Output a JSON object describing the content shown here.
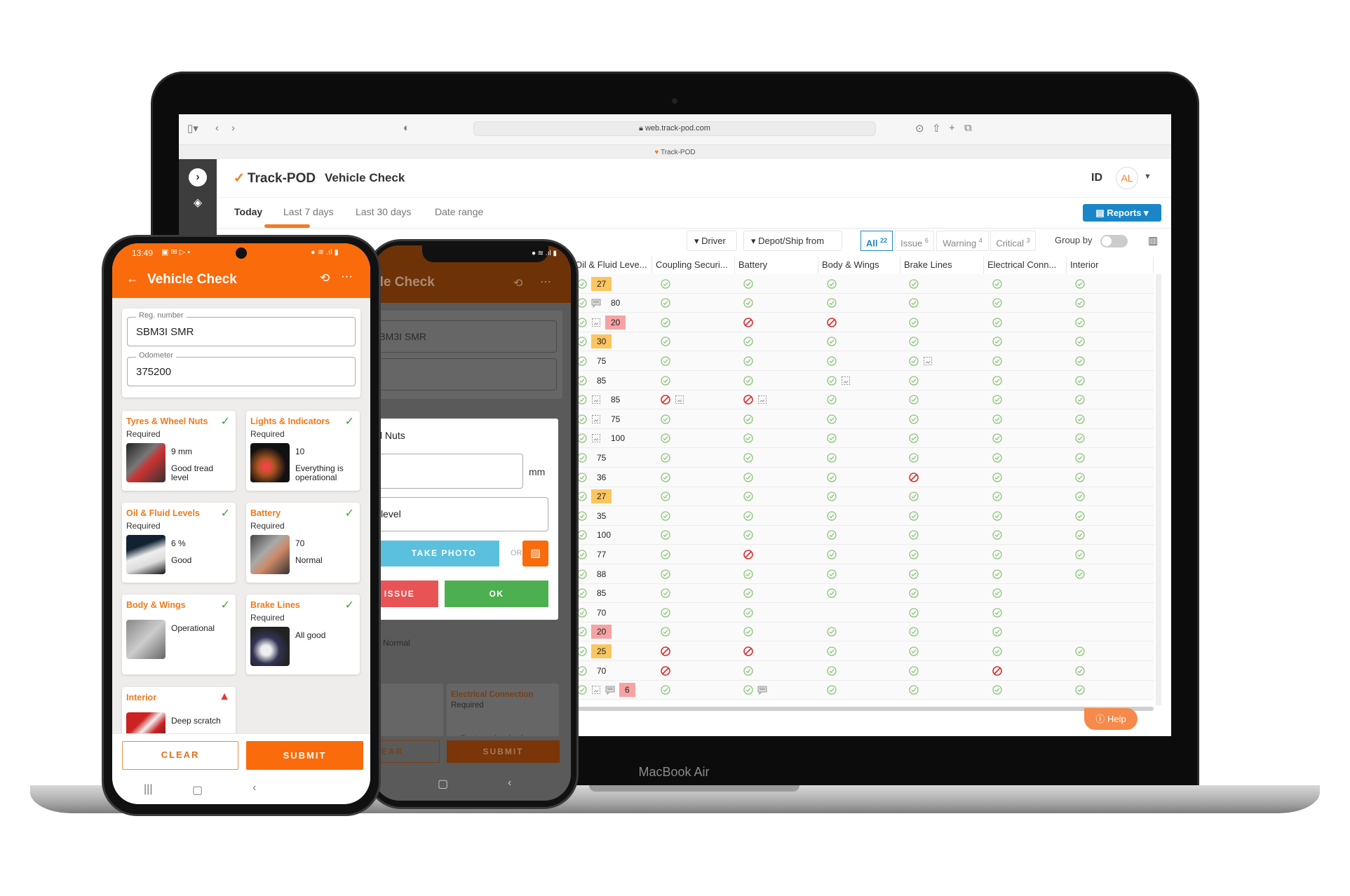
{
  "device_label": "MacBook Air",
  "browser": {
    "url": "web.track-pod.com",
    "tab_title": "Track-POD"
  },
  "app": {
    "logo_text": "Track-POD",
    "page_title": "Vehicle Check",
    "id_label": "ID",
    "avatar_initials": "AL",
    "brand_color": "#f47a20"
  },
  "tabs": [
    {
      "label": "Today",
      "active": true
    },
    {
      "label": "Last 7 days"
    },
    {
      "label": "Last 30 days"
    },
    {
      "label": "Date range"
    }
  ],
  "reports_label": "Reports",
  "filters": {
    "driver": "Driver",
    "depot": "Depot/Ship from",
    "segments": [
      {
        "label": "All",
        "count": "22",
        "active": true
      },
      {
        "label": "Issue",
        "count": "6"
      },
      {
        "label": "Warning",
        "count": "4"
      },
      {
        "label": "Critical",
        "count": "3"
      }
    ],
    "group_by": "Group by",
    "group_by_on": false
  },
  "table": {
    "columns": [
      "Oil & Fluid Leve...",
      "Coupling Securi...",
      "Battery",
      "Body & Wings",
      "Brake Lines",
      "Electrical Conn...",
      "Interior"
    ],
    "rows": [
      {
        "oil": {
          "icons": [],
          "value": "27",
          "level": "warn"
        },
        "cells": [
          "ok",
          "ok",
          "ok",
          "ok",
          "ok",
          "ok"
        ]
      },
      {
        "oil": {
          "icons": [
            "comment"
          ],
          "value": "80",
          "level": ""
        },
        "cells": [
          "ok",
          "ok",
          "ok",
          "ok",
          "ok",
          "ok"
        ]
      },
      {
        "oil": {
          "icons": [
            "photo"
          ],
          "value": "20",
          "level": "crit"
        },
        "cells": [
          "ok",
          "x",
          "x",
          "ok",
          "ok",
          "ok"
        ]
      },
      {
        "oil": {
          "icons": [],
          "value": "30",
          "level": "warn"
        },
        "cells": [
          "ok",
          "ok",
          "ok",
          "ok",
          "ok",
          "ok"
        ]
      },
      {
        "oil": {
          "icons": [],
          "value": "75",
          "level": ""
        },
        "cells": [
          "ok",
          "ok",
          "ok",
          "ok photo",
          "ok",
          "ok"
        ]
      },
      {
        "oil": {
          "icons": [],
          "value": "85",
          "level": ""
        },
        "cells": [
          "ok",
          "ok",
          "ok photo",
          "ok",
          "ok",
          "ok"
        ]
      },
      {
        "oil": {
          "icons": [
            "photo"
          ],
          "value": "85",
          "level": ""
        },
        "cells": [
          "x photo",
          "x photo",
          "ok",
          "ok",
          "ok",
          "ok"
        ]
      },
      {
        "oil": {
          "icons": [
            "photo"
          ],
          "value": "75",
          "level": ""
        },
        "cells": [
          "ok",
          "ok",
          "ok",
          "ok",
          "ok",
          "ok"
        ]
      },
      {
        "oil": {
          "icons": [
            "photo"
          ],
          "value": "100",
          "level": ""
        },
        "cells": [
          "ok",
          "ok",
          "ok",
          "ok",
          "ok",
          "ok"
        ]
      },
      {
        "oil": {
          "icons": [],
          "value": "75",
          "level": ""
        },
        "cells": [
          "ok",
          "ok",
          "ok",
          "ok",
          "ok",
          "ok"
        ]
      },
      {
        "oil": {
          "icons": [],
          "value": "36",
          "level": ""
        },
        "cells": [
          "ok",
          "ok",
          "ok",
          "x",
          "ok",
          "ok"
        ]
      },
      {
        "oil": {
          "icons": [],
          "value": "27",
          "level": "warn"
        },
        "cells": [
          "ok",
          "ok",
          "ok",
          "ok",
          "ok",
          "ok"
        ]
      },
      {
        "oil": {
          "icons": [],
          "value": "35",
          "level": ""
        },
        "cells": [
          "ok",
          "ok",
          "ok",
          "ok",
          "ok",
          "ok"
        ]
      },
      {
        "oil": {
          "icons": [],
          "value": "100",
          "level": ""
        },
        "cells": [
          "ok",
          "ok",
          "ok",
          "ok",
          "ok",
          "ok"
        ]
      },
      {
        "oil": {
          "icons": [],
          "value": "77",
          "level": ""
        },
        "cells": [
          "ok",
          "x",
          "ok",
          "ok",
          "ok",
          "ok"
        ]
      },
      {
        "oil": {
          "icons": [],
          "value": "88",
          "level": ""
        },
        "cells": [
          "ok",
          "ok",
          "ok",
          "ok",
          "ok",
          "ok"
        ]
      },
      {
        "oil": {
          "icons": [],
          "value": "85",
          "level": ""
        },
        "cells": [
          "ok",
          "ok",
          "ok",
          "ok",
          "ok",
          ""
        ]
      },
      {
        "oil": {
          "icons": [],
          "value": "70",
          "level": ""
        },
        "cells": [
          "ok",
          "ok",
          "",
          "ok",
          "ok",
          ""
        ]
      },
      {
        "oil": {
          "icons": [],
          "value": "20",
          "level": "crit"
        },
        "cells": [
          "ok",
          "ok",
          "ok",
          "ok",
          "ok",
          ""
        ]
      },
      {
        "oil": {
          "icons": [],
          "value": "25",
          "level": "warn"
        },
        "cells": [
          "x",
          "x",
          "ok",
          "ok",
          "ok",
          "ok"
        ]
      },
      {
        "oil": {
          "icons": [],
          "value": "70",
          "level": ""
        },
        "cells": [
          "x",
          "ok",
          "ok",
          "ok",
          "x",
          "ok"
        ]
      },
      {
        "oil": {
          "icons": [
            "photo",
            "comment"
          ],
          "value": "6",
          "level": "crit"
        },
        "cells": [
          "ok",
          "ok comment",
          "ok",
          "ok",
          "ok",
          "ok"
        ]
      }
    ]
  },
  "help_label": "Help",
  "front_phone": {
    "time": "13:49",
    "title": "Vehicle Check",
    "reg_label": "Reg. number",
    "reg_value": "SBM3I SMR",
    "odo_label": "Odometer",
    "odo_value": "375200",
    "cards": [
      {
        "title": "Tyres & Wheel Nuts",
        "status": "ok",
        "required": "Required",
        "line1": "9 mm",
        "line2": "Good tread level"
      },
      {
        "title": "Lights & Indicators",
        "status": "ok",
        "required": "Required",
        "line1": "10",
        "line2": "Everything is operational"
      },
      {
        "title": "Oil & Fluid Levels",
        "status": "ok",
        "required": "Required",
        "line1": "6 %",
        "line2": "Good"
      },
      {
        "title": "Battery",
        "status": "ok",
        "required": "Required",
        "line1": "70",
        "line2": "Normal"
      },
      {
        "title": "Body & Wings",
        "status": "ok",
        "required": "",
        "line1": "Operational",
        "line2": ""
      },
      {
        "title": "Brake Lines",
        "status": "ok",
        "required": "Required",
        "line1": "All good",
        "line2": ""
      },
      {
        "title": "Interior",
        "status": "warning",
        "required": "",
        "line1": "Deep scratch",
        "line2": ""
      }
    ],
    "clear_label": "CLEAR",
    "submit_label": "SUBMIT"
  },
  "back_phone": {
    "title": "Vehicle Check",
    "reg_value": "SBM3I SMR",
    "dialog": {
      "title": "Tyres & Wheel Nuts",
      "unit": "mm",
      "comment": "Good tread level",
      "take_photo": "TAKE PHOTO",
      "or": "OR",
      "issue": "ISSUE",
      "ok": "OK"
    },
    "behind_value": "Normal",
    "behind_card_title": "Electrical Connection",
    "behind_card_required": "Required",
    "tap_hint": "Tap to make check",
    "clear_label": "CLEAR",
    "submit_label": "SUBMIT"
  }
}
